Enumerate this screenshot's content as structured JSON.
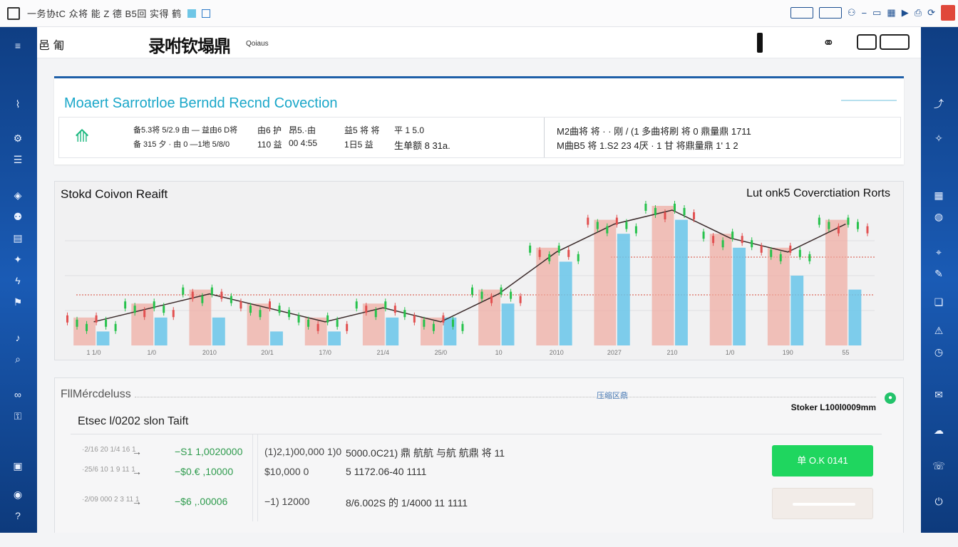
{
  "app": {
    "window_title": "一务协tC 众将 能 Z 德 B5回 实得 鹤",
    "brand": "录咐钦塌鼎",
    "brand_sub": "Qoiaus",
    "menu_label": "邑 匍"
  },
  "market": {
    "title": "Moaert Sarrotrloe Berndd Recnd Covection",
    "stats": [
      "备5.3将 5/2.9 由 —  益由6 D将",
      "备 315 夕 · 由 0 —1地 5/8/0",
      "由6 护",
      "110 益",
      "昂5.·由",
      "00 4:55",
      "益5 将 将",
      "1日5 益",
      "平   1 5.0",
      "生单额 8 31a.",
      "M2曲将 将 · · 刚 / (1 多曲将刷 将 0 鼎量鼎 1711",
      "M曲B5 将  1.S2 23 4厌 · 1 甘 将鼎量鼎 1' 1 2"
    ]
  },
  "chart": {
    "title_left": "Stokd Coivon Reaift",
    "title_right": "Lut onk5 Coverctiation Rorts",
    "x_tick_labels": [
      "1 1/0",
      "1/0",
      "2010",
      "20/1",
      "17/0",
      "21/4",
      "25/0",
      "10",
      "2010",
      "2027",
      "210",
      "1/0",
      "190",
      "55"
    ]
  },
  "chart_data": {
    "type": "bar",
    "title": "Stokd Coivon Reaift",
    "subtitle": "Lut onk5 Coverctiation Rorts",
    "categories": [
      "1 1/0",
      "1/0",
      "2010",
      "20/1",
      "17/0",
      "21/4",
      "25/0",
      "10",
      "2010",
      "2027",
      "210",
      "1/0",
      "190",
      "55"
    ],
    "series": [
      {
        "values": [
          1,
          2,
          2,
          1,
          1,
          2,
          2,
          3,
          6,
          8,
          9,
          7,
          5,
          4
        ]
      },
      {
        "values": [
          2,
          3,
          4,
          3,
          2,
          3,
          2,
          4,
          7,
          9,
          10,
          8,
          7,
          9
        ]
      }
    ],
    "ylim": [
      0,
      10
    ],
    "grid": true,
    "colors": {
      "up": "#27c24c",
      "down": "#e25050",
      "bar_blue": "#69c5ea",
      "bar_pink": "#f0aaa0",
      "line_dark": "#3a2a2a",
      "line_blue": "#2c5fa0",
      "ref_red": "#d64a3a"
    }
  },
  "orders": {
    "panel_title": "FllMércdeluss",
    "mid_label": "压缩区鼎",
    "right_label": "Stoker L100l0009mm",
    "subtitle": "Etsec l/0202 slon Taift",
    "rows": [
      {
        "label": "·2/16 20 1/4 16 1",
        "arrow": "→",
        "v1": "−S1 1,0020000",
        "v2": "(1)2,1)00,000 1)0",
        "v3": "5000.0C21) 鼎 航航 与航 航鼎 将 11"
      },
      {
        "label": "·25/6 10 1 9 11 1",
        "arrow": "→",
        "v1": "−$0.€ ,10000",
        "v2": "$10,000 0",
        "v3": "5 1172.06-40 1111"
      },
      {
        "label": "·2/09 000 2 3 11 1",
        "arrow": "→",
        "v1": "−$6 ,.00006",
        "v2": "−1) 12000",
        "v3": "8/6.002S 的 1/4000 11 1111"
      }
    ],
    "primary_button": "单 O.K 0141",
    "accent_green": "#1fd65f"
  }
}
